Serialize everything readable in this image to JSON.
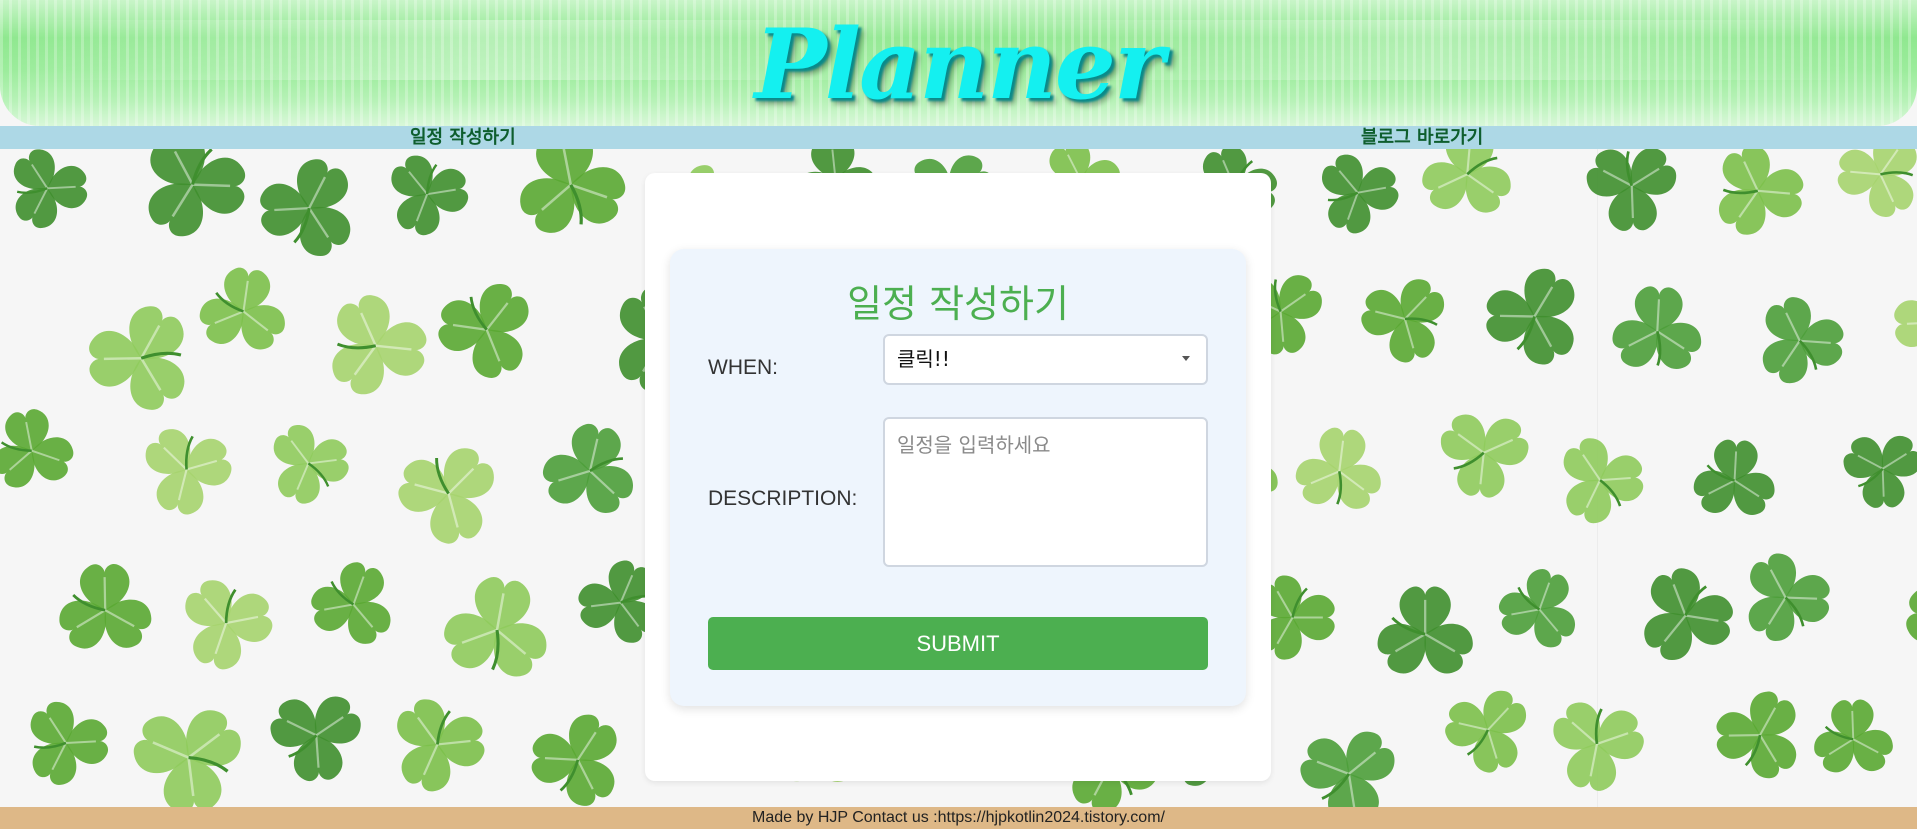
{
  "header": {
    "logo_text": "Planner"
  },
  "nav": {
    "left_link": "일정 작성하기",
    "right_link": "블로그 바로가기"
  },
  "form": {
    "title": "일정 작성하기",
    "when_label": "WHEN:",
    "when_select_value": "클릭!!",
    "description_label": "DESCRIPTION:",
    "description_placeholder": "일정을 입력하세요",
    "submit_label": "SUBMIT"
  },
  "footer": {
    "text": "Made by HJP Contact us :https://hjpkotlin2024.tistory.com/"
  },
  "colors": {
    "header_green": "#8fe88f",
    "logo_cyan": "#14f0f0",
    "nav_bg": "#add8e6",
    "nav_text": "#0e5e2e",
    "form_title": "#4caf50",
    "submit_bg": "#4caf50",
    "form_box_bg": "#eef5fd",
    "footer_bg": "#deb887"
  },
  "icons": {
    "select_caret": "chevron-down-icon",
    "background_pattern": "clover-icon"
  }
}
